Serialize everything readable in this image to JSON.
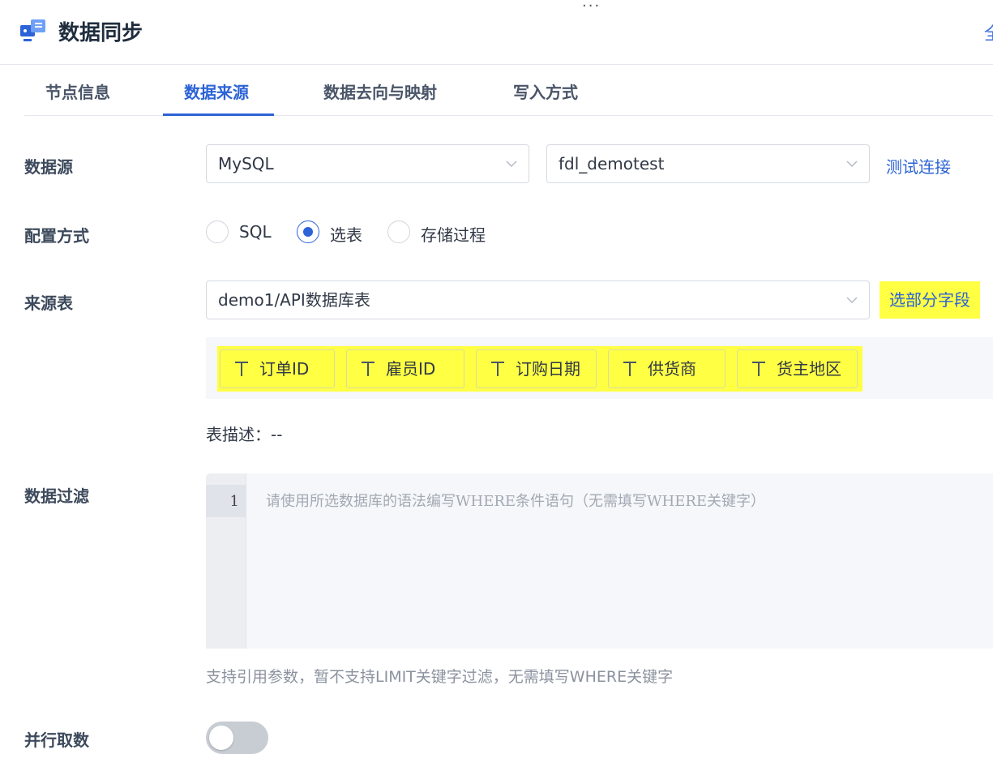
{
  "header": {
    "title": "数据同步",
    "more": "...",
    "edge_text": "全"
  },
  "tabs": [
    {
      "label": "节点信息",
      "active": false
    },
    {
      "label": "数据来源",
      "active": true
    },
    {
      "label": "数据去向与映射",
      "active": false
    },
    {
      "label": "写入方式",
      "active": false
    }
  ],
  "form": {
    "datasource": {
      "label": "数据源",
      "type_value": "MySQL",
      "db_value": "fdl_demotest",
      "test_link": "测试连接"
    },
    "config": {
      "label": "配置方式",
      "options": [
        {
          "label": "SQL",
          "checked": false
        },
        {
          "label": "选表",
          "checked": true
        },
        {
          "label": "存储过程",
          "checked": false
        }
      ]
    },
    "source_table": {
      "label": "来源表",
      "value": "demo1/API数据库表",
      "select_fields_button": "选部分字段"
    },
    "fields": [
      "订单ID",
      "雇员ID",
      "订购日期",
      "供货商",
      "货主地区"
    ],
    "table_desc": "表描述：--",
    "filter": {
      "label": "数据过滤",
      "line_number": "1",
      "placeholder": "请使用所选数据库的语法编写WHERE条件语句（无需填写WHERE关键字）",
      "hint": "支持引用参数，暂不支持LIMIT关键字过滤，无需填写WHERE关键字"
    },
    "parallel": {
      "label": "并行取数",
      "enabled": false
    }
  },
  "colors": {
    "accent": "#2c63d6",
    "highlight": "#ffff44",
    "toggle_off": "#c8ccd3"
  }
}
